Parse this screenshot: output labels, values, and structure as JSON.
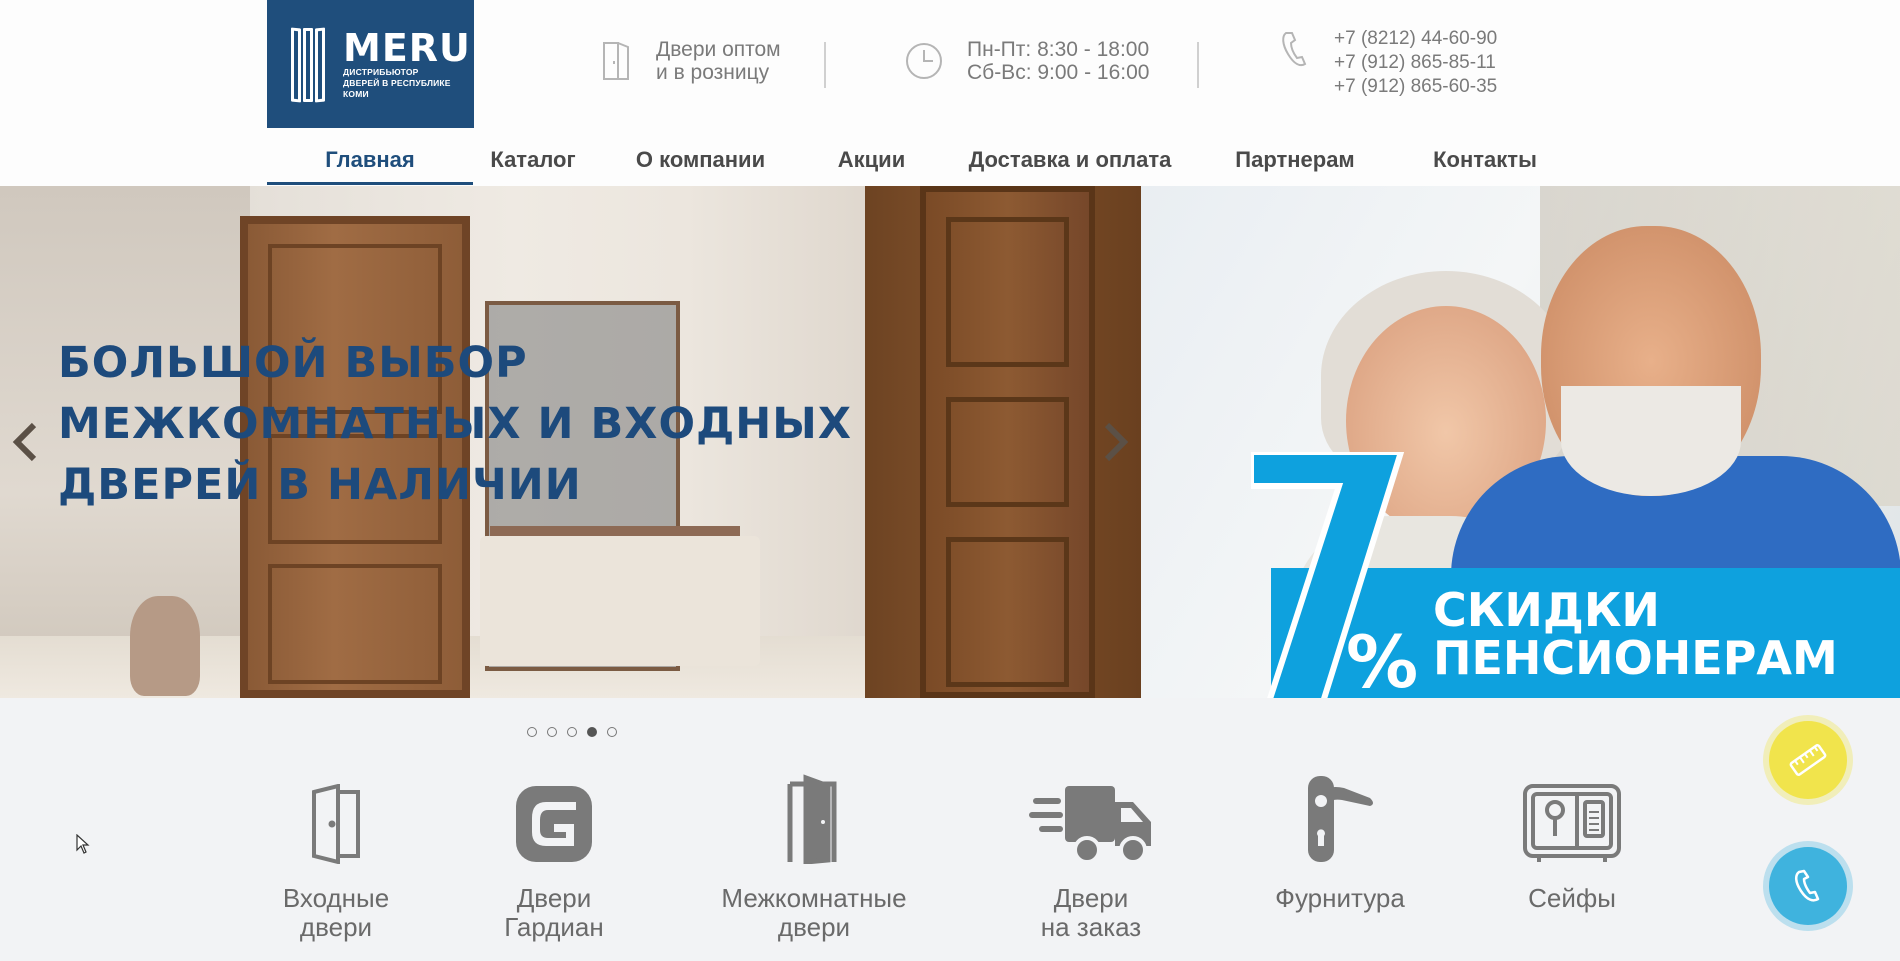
{
  "header": {
    "logo": {
      "name": "MERU",
      "subtitle": "ДИСТРИБЬЮТОР ДВЕРЕЙ В РЕСПУБЛИКЕ КОМИ",
      "icon": "doors-logo-icon"
    },
    "wholesale": {
      "line1": "Двери оптом",
      "line2": "и в розницу",
      "icon": "door-icon"
    },
    "hours": {
      "line1": "Пн-Пт: 8:30 - 18:00",
      "line2": "Сб-Вс: 9:00 - 16:00",
      "icon": "clock-icon"
    },
    "phones": {
      "phone1": "+7 (8212) 44-60-90",
      "phone2": "+7 (912) 865-85-11",
      "phone3": "+7 (912) 865-60-35",
      "icon": "phone-handset-icon"
    }
  },
  "nav": {
    "items": [
      {
        "label": "Главная",
        "active": true
      },
      {
        "label": "Каталог"
      },
      {
        "label": "О компании"
      },
      {
        "label": "Акции"
      },
      {
        "label": "Доставка и оплата"
      },
      {
        "label": "Партнерам"
      },
      {
        "label": "Контакты"
      }
    ]
  },
  "slider": {
    "headline1": "БОЛЬШОЙ ВЫБОР",
    "headline2": "МЕЖКОМНАТНЫХ И ВХОДНЫХ",
    "headline3": "ДВЕРЕЙ В НАЛИЧИИ",
    "prev": "‹",
    "next": "›",
    "dots": 5,
    "active_dot": 4
  },
  "promo": {
    "number": "7",
    "percent": "%",
    "line1": "СКИДКИ",
    "line2": "ПЕНСИОНЕРАМ"
  },
  "categories": [
    {
      "label": "Входные\nдвери",
      "icon": "entrance-door-icon"
    },
    {
      "label": "Двери\nГардиан",
      "icon": "guardian-logo-icon"
    },
    {
      "label": "Межкомнатные\nдвери",
      "icon": "interior-door-icon"
    },
    {
      "label": "Двери\nна заказ",
      "icon": "delivery-truck-icon"
    },
    {
      "label": "Фурнитура",
      "icon": "door-handle-icon"
    },
    {
      "label": "Сейфы",
      "icon": "safe-icon"
    }
  ],
  "floating": {
    "measure": "ruler-icon",
    "call": "phone-icon"
  },
  "colors": {
    "brand": "#1f4e7c",
    "promo": "#0ea1de",
    "accent_yellow": "#f1e44c",
    "call_blue": "#3fb3de"
  }
}
